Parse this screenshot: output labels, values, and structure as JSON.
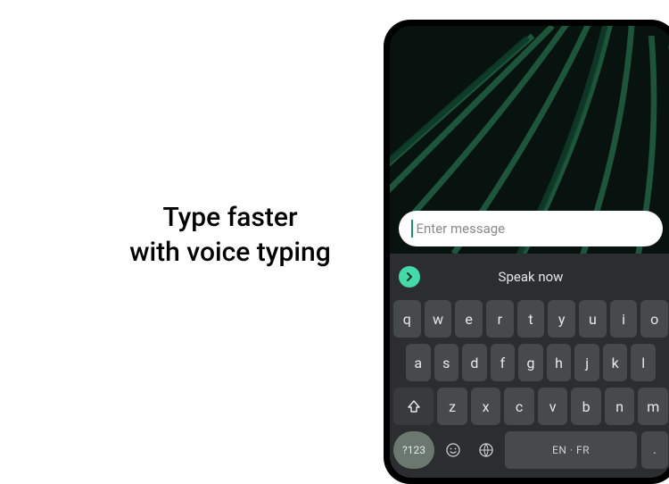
{
  "marketing": {
    "line1": "Type faster",
    "line2": "with voice typing"
  },
  "input": {
    "placeholder": "Enter message"
  },
  "suggestion": {
    "speak_now": "Speak now"
  },
  "keyboard": {
    "row1": [
      "q",
      "w",
      "e",
      "r",
      "t",
      "y",
      "u",
      "i",
      "o"
    ],
    "row2": [
      "a",
      "s",
      "d",
      "f",
      "g",
      "h",
      "j",
      "k",
      "l"
    ],
    "row3": [
      "z",
      "x",
      "c",
      "v",
      "b",
      "n",
      "m"
    ],
    "symbols_label": "?123",
    "space_label": "EN · FR",
    "period_label": "."
  },
  "colors": {
    "accent": "#44d9a6",
    "keyboard_bg": "#2b2d30",
    "key_bg": "#474a4d"
  }
}
